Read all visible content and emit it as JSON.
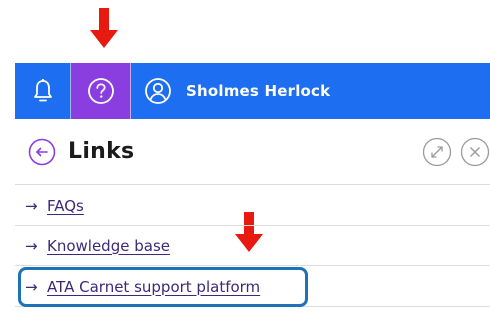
{
  "topbar": {
    "user_name": "Sholmes Herlock",
    "colors": {
      "bar": "#1d6ef0",
      "help_active": "#8b3ee0"
    }
  },
  "panel": {
    "title": "Links"
  },
  "links": [
    {
      "label": "FAQs"
    },
    {
      "label": "Knowledge base"
    },
    {
      "label": "ATA Carnet support platform"
    }
  ],
  "icons": {
    "notifications": "bell-icon",
    "help": "question-circle-icon",
    "user": "user-circle-icon",
    "back": "arrow-left-circle-icon",
    "expand": "expand-icon",
    "close": "close-circle-icon",
    "link_arrow": "→"
  },
  "annotations": {
    "arrow_color": "#e8190f",
    "highlight_color": "#1d72b8"
  }
}
